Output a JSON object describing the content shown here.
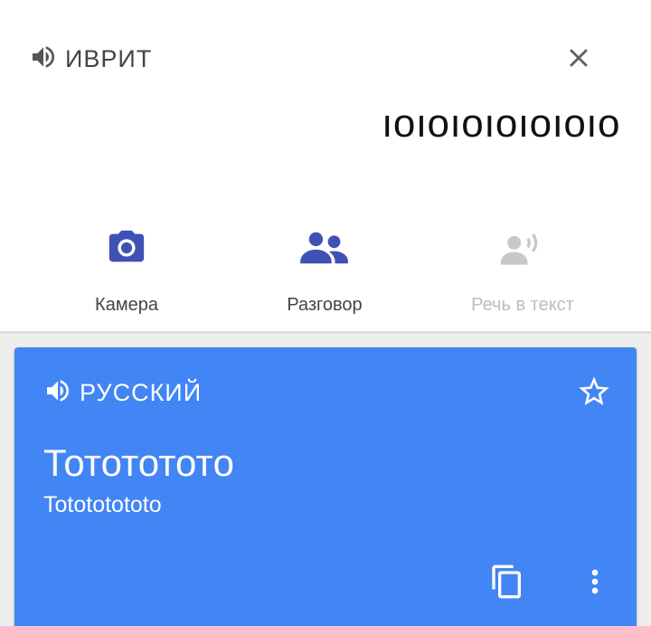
{
  "source": {
    "language": "ИВРИТ",
    "text": "ıoıoıoıoıoıoıo",
    "speaker_icon": "volume-icon",
    "close_icon": "close-icon"
  },
  "tools": {
    "camera": {
      "label": "Камера",
      "icon": "camera-icon"
    },
    "conversation": {
      "label": "Разговор",
      "icon": "conversation-icon"
    },
    "speech_to_text": {
      "label": "Речь в текст",
      "icon": "speech-icon",
      "enabled": false
    }
  },
  "result": {
    "language": "РУССКИЙ",
    "translation": "Тототототo",
    "transliteration": "Totototototo",
    "star_icon": "star-outline-icon",
    "copy_icon": "copy-icon",
    "more_icon": "more-vert-icon"
  },
  "colors": {
    "accent": "#3f51b5",
    "card": "#4285f4",
    "disabled": "#bdbdbd",
    "text": "#444444"
  }
}
